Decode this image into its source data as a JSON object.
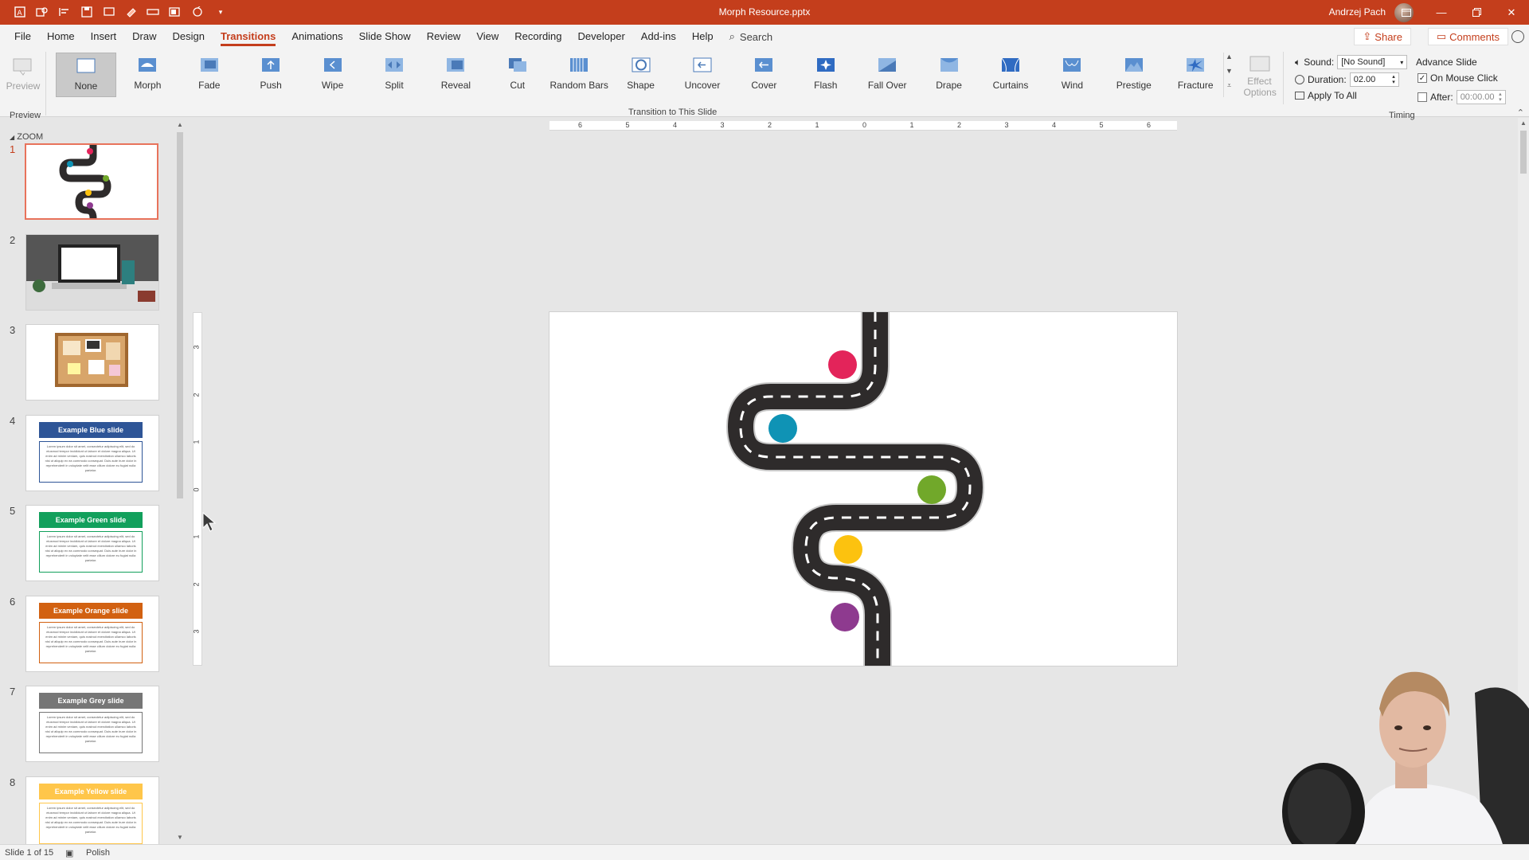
{
  "window": {
    "title": "Morph Resource.pptx",
    "user": "Andrzej Pach",
    "minimize_icon": "minimize-icon",
    "restore_icon": "restore-icon",
    "close_icon": "close-icon"
  },
  "menu": {
    "tabs": [
      "File",
      "Home",
      "Insert",
      "Draw",
      "Design",
      "Transitions",
      "Animations",
      "Slide Show",
      "Review",
      "View",
      "Recording",
      "Developer",
      "Add-ins",
      "Help"
    ],
    "active_tab": "Transitions",
    "search": "Search",
    "share": "Share",
    "comments": "Comments"
  },
  "ribbon": {
    "preview_label": "Preview",
    "preview_group": "Preview",
    "transitions": [
      "None",
      "Morph",
      "Fade",
      "Push",
      "Wipe",
      "Split",
      "Reveal",
      "Cut",
      "Random Bars",
      "Shape",
      "Uncover",
      "Cover",
      "Flash",
      "Fall Over",
      "Drape",
      "Curtains",
      "Wind",
      "Prestige",
      "Fracture"
    ],
    "selected_transition": "None",
    "transition_group": "Transition to This Slide",
    "effect_options": "Effect Options",
    "timing": {
      "sound_label": "Sound:",
      "sound_value": "[No Sound]",
      "duration_label": "Duration:",
      "duration_value": "02.00",
      "apply_all": "Apply To All",
      "advance_label": "Advance Slide",
      "on_click_label": "On Mouse Click",
      "on_click_checked": true,
      "after_label": "After:",
      "after_value": "00:00.00",
      "after_checked": false,
      "group": "Timing"
    }
  },
  "thumbnails": {
    "section": "ZOOM",
    "slides": [
      {
        "num": "1",
        "kind": "road"
      },
      {
        "num": "2",
        "kind": "laptop"
      },
      {
        "num": "3",
        "kind": "board"
      },
      {
        "num": "4",
        "kind": "example",
        "title": "Example Blue slide",
        "color": "#2e5597"
      },
      {
        "num": "5",
        "kind": "example",
        "title": "Example Green slide",
        "color": "#12a05c"
      },
      {
        "num": "6",
        "kind": "example",
        "title": "Example Orange slide",
        "color": "#d26111"
      },
      {
        "num": "7",
        "kind": "example",
        "title": "Example Grey slide",
        "color": "#767676"
      },
      {
        "num": "8",
        "kind": "example",
        "title": "Example Yellow slide",
        "color": "#ffc64a"
      }
    ],
    "lorem": "Lorem ipsum dolor sit amet, consectetur adipiscing elit, sed do eiusmod tempor incididunt ut labore et dolore magna aliqua. Ut enim ad minim veniam, quis nostrud exercitation ullamco laboris nisi ut aliquip ex ea commodo consequat. Duis aute irure dolor in reprehenderit in voluptate velit esse cillum dolore eu fugiat nulla pariatur."
  },
  "rulers": {
    "horizontal": [
      "6",
      "5",
      "4",
      "3",
      "2",
      "1",
      "0",
      "1",
      "2",
      "3",
      "4",
      "5",
      "6"
    ],
    "vertical": [
      "3",
      "2",
      "1",
      "0",
      "1",
      "2",
      "3"
    ]
  },
  "slide": {
    "dots": [
      {
        "name": "pink",
        "color": "#e3245a"
      },
      {
        "name": "teal",
        "color": "#0f93b5"
      },
      {
        "name": "green",
        "color": "#71a82a"
      },
      {
        "name": "yellow",
        "color": "#fcc20f"
      },
      {
        "name": "purple",
        "color": "#8e3a8f"
      }
    ],
    "road_color": "#2e2b2b"
  },
  "status": {
    "slide_info": "Slide 1 of 15",
    "language": "Polish"
  }
}
